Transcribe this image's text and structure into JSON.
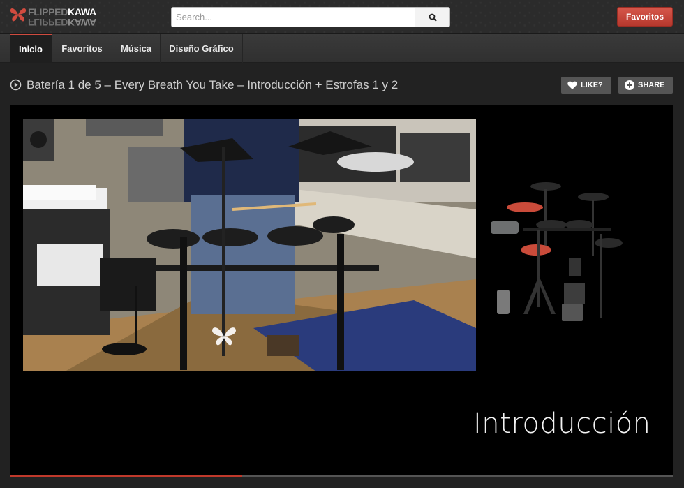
{
  "header": {
    "logo_part1": "FLIPPED",
    "logo_part2": "KAWA",
    "search_placeholder": "Search...",
    "favorites_button": "Favoritos"
  },
  "nav": {
    "tabs": [
      {
        "label": "Inicio",
        "active": true
      },
      {
        "label": "Favoritos",
        "active": false
      },
      {
        "label": "Música",
        "active": false
      },
      {
        "label": "Diseño Gráfico",
        "active": false
      }
    ]
  },
  "video": {
    "title": "Batería 1 de 5 – Every Breath You Take – Introducción + Estrofas 1 y 2",
    "like_label": "LIKE?",
    "share_label": "SHARE",
    "caption": "Introducción",
    "progress_percent": 35
  },
  "colors": {
    "accent": "#c0392b",
    "header_bg": "#2b2b2b",
    "page_bg": "#222222",
    "button_gray": "#555555"
  },
  "icons": {
    "logo": "butterfly-icon",
    "search": "search-icon",
    "title": "play-circle-icon",
    "like": "heart-icon",
    "share": "plus-circle-icon"
  }
}
